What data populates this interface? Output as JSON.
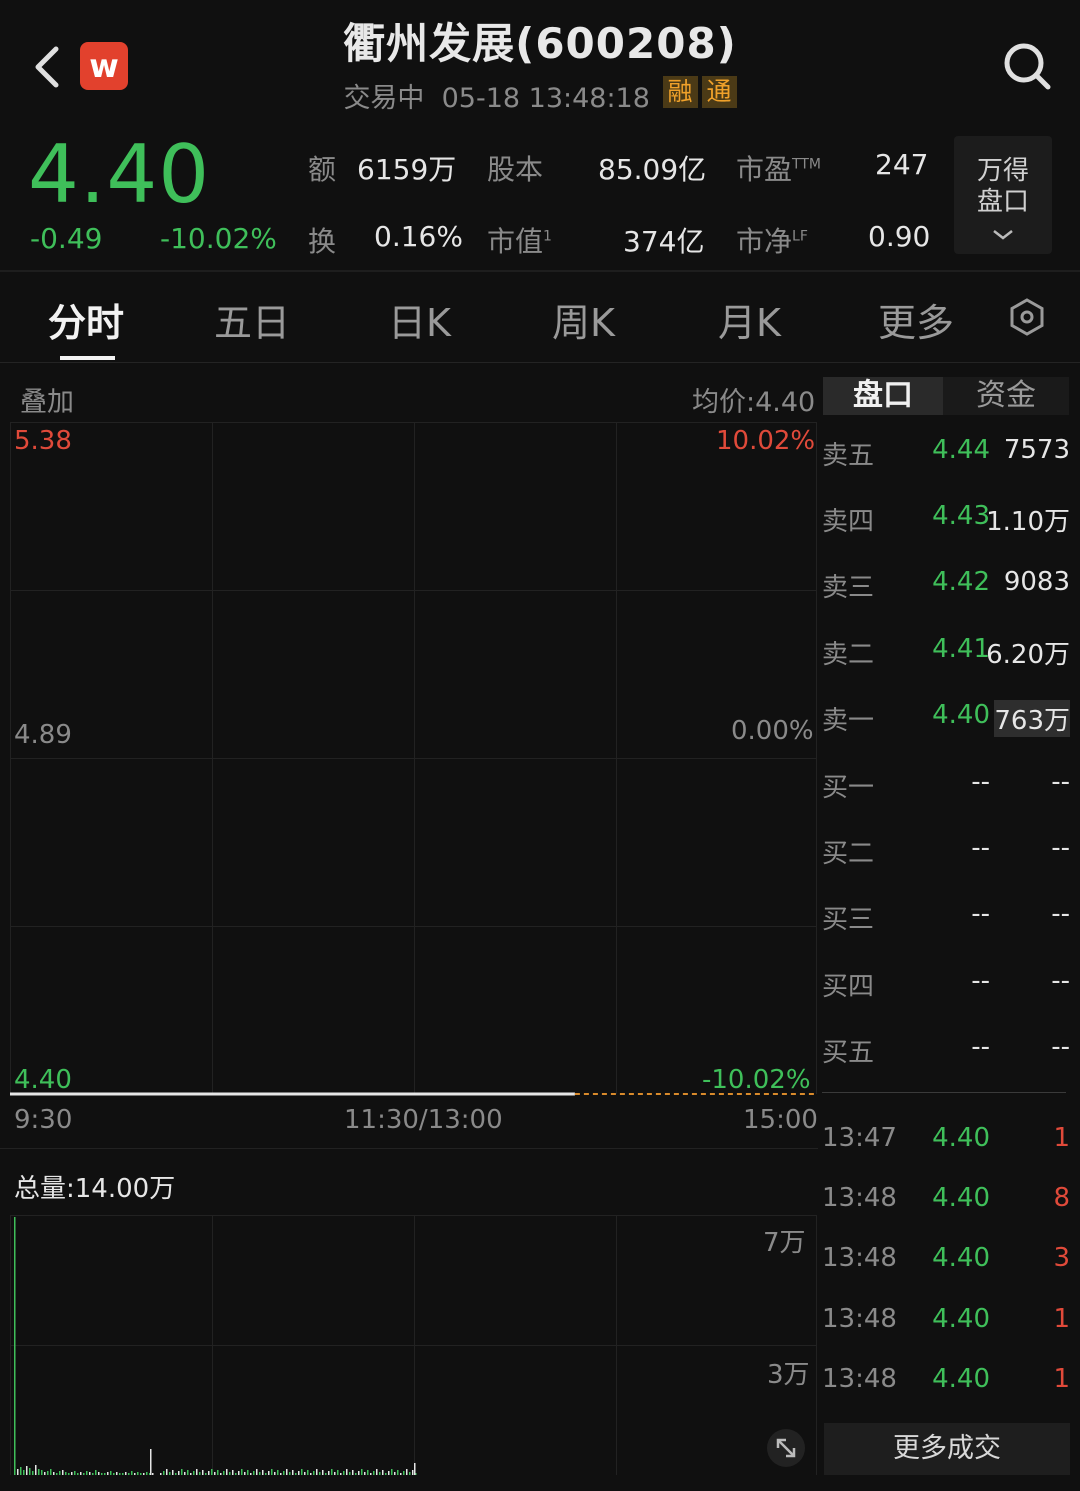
{
  "header": {
    "title": "衢州发展(600208)",
    "status": "交易中",
    "datetime": "05-18 13:48:18",
    "badge_rong": "融",
    "badge_tong": "通",
    "logo_letter": "w"
  },
  "quote": {
    "price": "4.40",
    "change": "-0.49",
    "change_pct": "-10.02%",
    "stats": {
      "amount_label": "额",
      "amount_value": "6159万",
      "turnover_label": "换",
      "turnover_value": "0.16%",
      "shares_label": "股本",
      "shares_value": "85.09亿",
      "mktcap_label": "市值",
      "mktcap_sup": "1",
      "mktcap_value": "374亿",
      "pe_label": "市盈",
      "pe_sup": "TTM",
      "pe_value": "247",
      "pb_label": "市净",
      "pb_sup": "LF",
      "pb_value": "0.90"
    },
    "wind_button": {
      "line1": "万得",
      "line2": "盘口"
    }
  },
  "tabs": [
    "分时",
    "五日",
    "日K",
    "周K",
    "月K",
    "更多"
  ],
  "active_tab": "分时",
  "chart": {
    "overlay_label": "叠加",
    "avg_price": "均价:4.40",
    "y_high": "5.38",
    "y_mid": "4.89",
    "y_low": "4.40",
    "pct_high": "10.02%",
    "pct_mid": "0.00%",
    "pct_low": "-10.02%",
    "time_start": "9:30",
    "time_mid": "11:30/13:00",
    "time_end": "15:00",
    "volume_total": "总量:14.00万",
    "vol_tick_high": "7万",
    "vol_tick_mid": "3万"
  },
  "chart_data": {
    "type": "line",
    "title": "",
    "xlabel": "",
    "ylabel": "",
    "x_range": [
      "9:30",
      "15:00"
    ],
    "ylim": [
      4.4,
      5.38
    ],
    "series": [
      {
        "values": [
          4.4,
          4.4
        ]
      }
    ],
    "volume_ylim": [
      0,
      70000
    ]
  },
  "orderbook": {
    "tab_active": "盘口",
    "tab_other": "资金",
    "asks": [
      {
        "label": "卖五",
        "price": "4.44",
        "volume": "7573"
      },
      {
        "label": "卖四",
        "price": "4.43",
        "volume": "1.10万"
      },
      {
        "label": "卖三",
        "price": "4.42",
        "volume": "9083"
      },
      {
        "label": "卖二",
        "price": "4.41",
        "volume": "6.20万"
      },
      {
        "label": "卖一",
        "price": "4.40",
        "volume": "763万"
      }
    ],
    "bids": [
      {
        "label": "买一",
        "price": "--",
        "volume": "--"
      },
      {
        "label": "买二",
        "price": "--",
        "volume": "--"
      },
      {
        "label": "买三",
        "price": "--",
        "volume": "--"
      },
      {
        "label": "买四",
        "price": "--",
        "volume": "--"
      },
      {
        "label": "买五",
        "price": "--",
        "volume": "--"
      }
    ]
  },
  "trades": [
    {
      "time": "13:47",
      "price": "4.40",
      "volume": "1"
    },
    {
      "time": "13:48",
      "price": "4.40",
      "volume": "8"
    },
    {
      "time": "13:48",
      "price": "4.40",
      "volume": "3"
    },
    {
      "time": "13:48",
      "price": "4.40",
      "volume": "1"
    },
    {
      "time": "13:48",
      "price": "4.40",
      "volume": "1"
    }
  ],
  "more_trades_label": "更多成交",
  "colors": {
    "up": "#e04a3a",
    "down": "#3fbf5a",
    "badge": "#f0a12a",
    "background": "#101010"
  }
}
